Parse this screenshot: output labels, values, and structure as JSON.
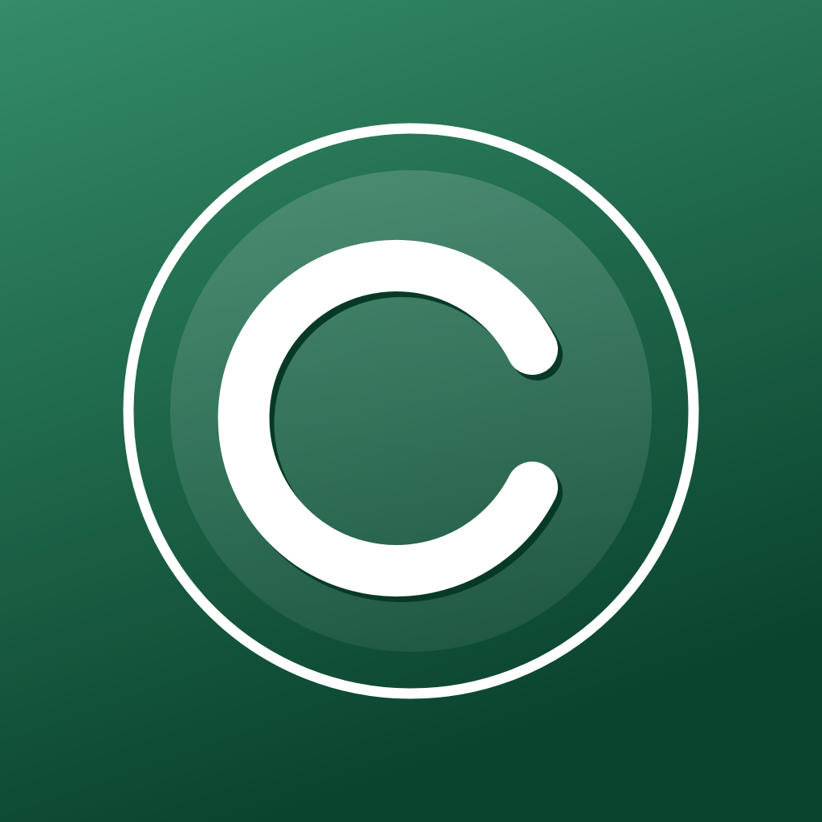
{
  "icon": {
    "letter": "C",
    "semantic": "copyright-c-logo-icon",
    "colors": {
      "background_top": "#348c68",
      "background_bottom": "#0a432e",
      "ring": "#ffffff",
      "inner_disc": "#ffffff",
      "letter": "#ffffff",
      "letter_shadow": "#073a26"
    }
  }
}
